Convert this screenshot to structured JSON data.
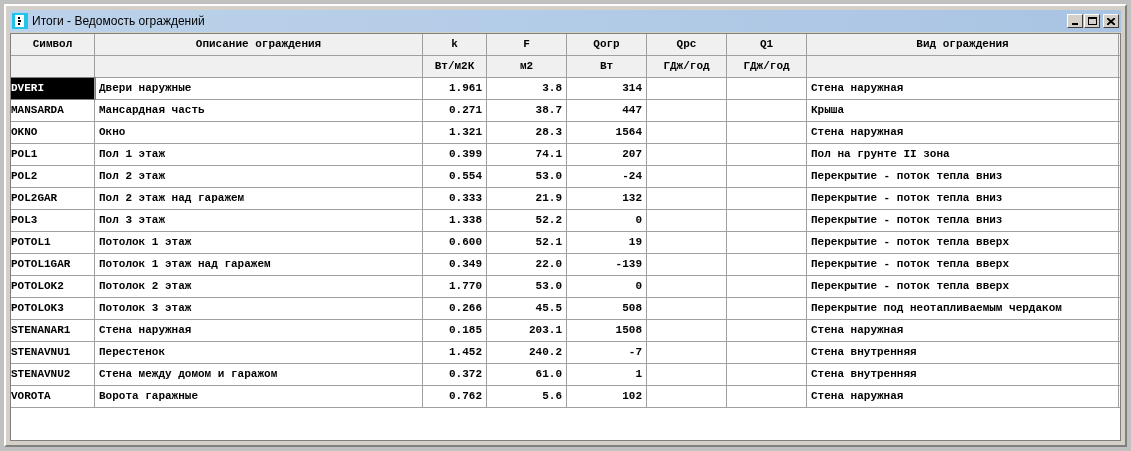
{
  "window": {
    "title": "Итоги - Ведомость ограждений"
  },
  "table": {
    "columns": [
      {
        "name": "Символ"
      },
      {
        "name": "Описание ограждения"
      },
      {
        "name": "k",
        "unit": "Вт/м2К"
      },
      {
        "name": "F",
        "unit": "м2"
      },
      {
        "name": "Qогр",
        "unit": "Вт"
      },
      {
        "name": "Qрс",
        "unit": "ГДж/год"
      },
      {
        "name": "Q1",
        "unit": "ГДж/год"
      },
      {
        "name": "Вид ограждения"
      }
    ],
    "rows": [
      {
        "selected": true,
        "cells": [
          "DVERI",
          "Двери наружные",
          "1.961",
          "3.8",
          "314",
          "",
          "",
          "Стена наружная"
        ]
      },
      {
        "selected": false,
        "cells": [
          "MANSARDA",
          "Мансардная часть",
          "0.271",
          "38.7",
          "447",
          "",
          "",
          "Крыша"
        ]
      },
      {
        "selected": false,
        "cells": [
          "OKNO",
          "Окно",
          "1.321",
          "28.3",
          "1564",
          "",
          "",
          "Стена наружная"
        ]
      },
      {
        "selected": false,
        "cells": [
          "POL1",
          "Пол 1 этаж",
          "0.399",
          "74.1",
          "207",
          "",
          "",
          "Пол на грунте II зона"
        ]
      },
      {
        "selected": false,
        "cells": [
          "POL2",
          "Пол 2 этаж",
          "0.554",
          "53.0",
          "-24",
          "",
          "",
          "Перекрытие - поток тепла вниз"
        ]
      },
      {
        "selected": false,
        "cells": [
          "POL2GAR",
          "Пол 2 этаж над гаражем",
          "0.333",
          "21.9",
          "132",
          "",
          "",
          "Перекрытие - поток тепла вниз"
        ]
      },
      {
        "selected": false,
        "cells": [
          "POL3",
          "Пол 3 этаж",
          "1.338",
          "52.2",
          "0",
          "",
          "",
          "Перекрытие - поток тепла вниз"
        ]
      },
      {
        "selected": false,
        "cells": [
          "POTOL1",
          "Потолок 1 этаж",
          "0.600",
          "52.1",
          "19",
          "",
          "",
          "Перекрытие - поток тепла вверх"
        ]
      },
      {
        "selected": false,
        "cells": [
          "POTOL1GAR",
          "Потолок 1 этаж над гаражем",
          "0.349",
          "22.0",
          "-139",
          "",
          "",
          "Перекрытие - поток тепла вверх"
        ]
      },
      {
        "selected": false,
        "cells": [
          "POTOLOK2",
          "Потолок 2 этаж",
          "1.770",
          "53.0",
          "0",
          "",
          "",
          "Перекрытие - поток тепла вверх"
        ]
      },
      {
        "selected": false,
        "cells": [
          "POTOLOK3",
          "Потолок 3 этаж",
          "0.266",
          "45.5",
          "508",
          "",
          "",
          "Перекрытие под неотапливаемым чердаком"
        ]
      },
      {
        "selected": false,
        "cells": [
          "STENANAR1",
          "Стена наружная",
          "0.185",
          "203.1",
          "1508",
          "",
          "",
          "Стена наружная"
        ]
      },
      {
        "selected": false,
        "cells": [
          "STENAVNU1",
          "Перестенок",
          "1.452",
          "240.2",
          "-7",
          "",
          "",
          "Стена внутренняя"
        ]
      },
      {
        "selected": false,
        "cells": [
          "STENAVNU2",
          "Стена между домом и гаражом",
          "0.372",
          "61.0",
          "1",
          "",
          "",
          "Стена внутренняя"
        ]
      },
      {
        "selected": false,
        "cells": [
          "VOROTA",
          "Ворота гаражные",
          "0.762",
          "5.6",
          "102",
          "",
          "",
          "Стена наружная"
        ]
      }
    ]
  }
}
